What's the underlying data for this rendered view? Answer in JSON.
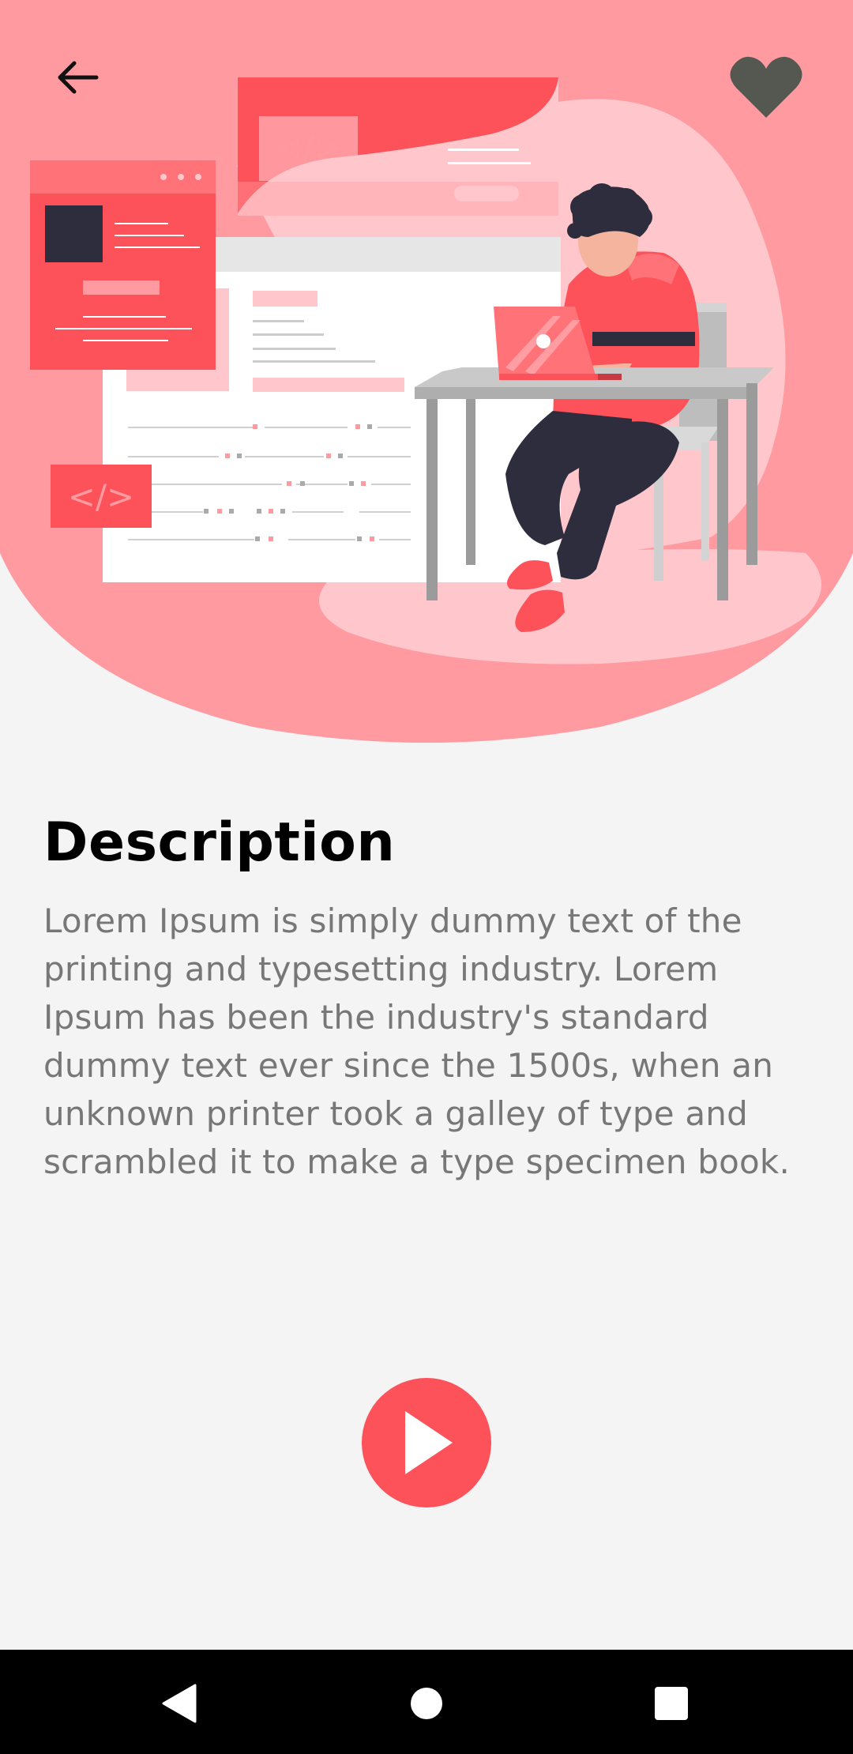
{
  "colors": {
    "accent": "#fe525a",
    "hero_background": "#fe9aa0",
    "hero_blob": "#ffc7cc",
    "heart": "#545850",
    "background": "#f4f4f4",
    "description_text": "#777777"
  },
  "header": {
    "back_icon": "arrow-left-icon",
    "favorite_icon": "heart-icon"
  },
  "illustration": {
    "subject": "developer-at-desk-illustration",
    "code_tag_text": "</>"
  },
  "main": {
    "title": "Description",
    "description": "Lorem Ipsum is simply dummy text of the printing and typesetting industry. Lorem Ipsum has been the industry's standard dummy text ever since the 1500s, when an unknown printer took a galley of type and scrambled it to make a type specimen book."
  },
  "actions": {
    "play_icon": "play-icon"
  },
  "navigation_bar": {
    "back_icon": "nav-back-icon",
    "home_icon": "nav-home-icon",
    "recents_icon": "nav-recents-icon"
  }
}
